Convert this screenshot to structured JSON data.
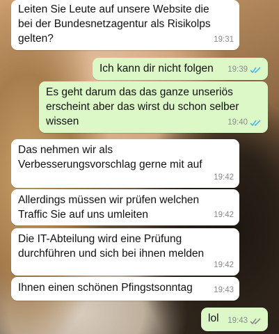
{
  "messages": [
    {
      "text": "Leiten Sie Leute auf unsere Website die bei der Bundesnetzagentur als Risikolps gelten?",
      "time": "19:31",
      "side": "in"
    },
    {
      "text": "Ich kann dir nicht folgen",
      "time": "19:39",
      "side": "out",
      "status": "read",
      "status_icon": "double-check-icon",
      "status_color": "#4fb6ec"
    },
    {
      "text": "Es geht darum das das ganze unseriös erscheint aber das wirst du schon selber wissen",
      "time": "19:40",
      "side": "out",
      "status": "read",
      "status_icon": "double-check-icon",
      "status_color": "#4fb6ec"
    },
    {
      "text": "Das nehmen wir als Verbesserungsvorschlag gerne mit auf",
      "time": "19:42",
      "side": "in"
    },
    {
      "text": "Allerdings müssen wir prüfen welchen Traffic Sie auf uns umleiten",
      "time": "19:42",
      "side": "in"
    },
    {
      "text": "Die IT-Abteilung wird eine Prüfung durchführen und sich bei ihnen melden",
      "time": "19:42",
      "side": "in"
    },
    {
      "text": "Ihnen einen schönen Pfingstsonntag",
      "time": "19:43",
      "side": "in"
    },
    {
      "text": "lol",
      "time": "19:43",
      "side": "out",
      "status": "delivered",
      "status_icon": "double-check-icon",
      "status_color": "#8a8a8a"
    }
  ],
  "colors": {
    "incoming_bubble": "#ffffff",
    "outgoing_bubble": "#dcf8c6",
    "read_tick": "#4fb6ec",
    "delivered_tick": "#8a8a8a"
  }
}
